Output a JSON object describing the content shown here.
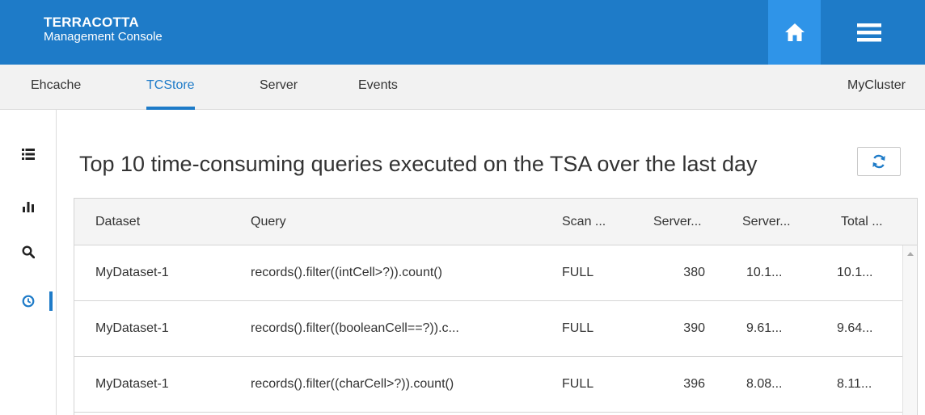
{
  "header": {
    "brand_name": "TERRACOTTA",
    "brand_sub": "Management Console",
    "home_icon": "home-icon",
    "menu_icon": "hamburger-menu-icon",
    "color": "#1e7bc8",
    "home_color": "#2f94e8"
  },
  "nav": {
    "tabs": [
      {
        "label": "Ehcache",
        "active": false
      },
      {
        "label": "TCStore",
        "active": true
      },
      {
        "label": "Server",
        "active": false
      },
      {
        "label": "Events",
        "active": false
      }
    ],
    "cluster": "MyCluster"
  },
  "sidebar": {
    "items": [
      {
        "icon": "list-icon",
        "active": false
      },
      {
        "icon": "bar-chart-icon",
        "active": false
      },
      {
        "icon": "search-icon",
        "active": false
      },
      {
        "icon": "clock-icon",
        "active": true
      }
    ]
  },
  "main": {
    "title": "Top 10 time-consuming queries executed on the TSA over the last day",
    "refresh_icon": "refresh-icon",
    "table": {
      "columns": [
        "Dataset",
        "Query",
        "Scan ...",
        "Server...",
        "Server...",
        "Total ..."
      ],
      "rows": [
        [
          "MyDataset-1",
          "records().filter((intCell>?)).count()",
          "FULL",
          "380",
          "10.1...",
          "10.1..."
        ],
        [
          "MyDataset-1",
          "records().filter((booleanCell==?)).c...",
          "FULL",
          "390",
          "9.61...",
          "9.64..."
        ],
        [
          "MyDataset-1",
          "records().filter((charCell>?)).count()",
          "FULL",
          "396",
          "8.08...",
          "8.11..."
        ]
      ]
    }
  }
}
